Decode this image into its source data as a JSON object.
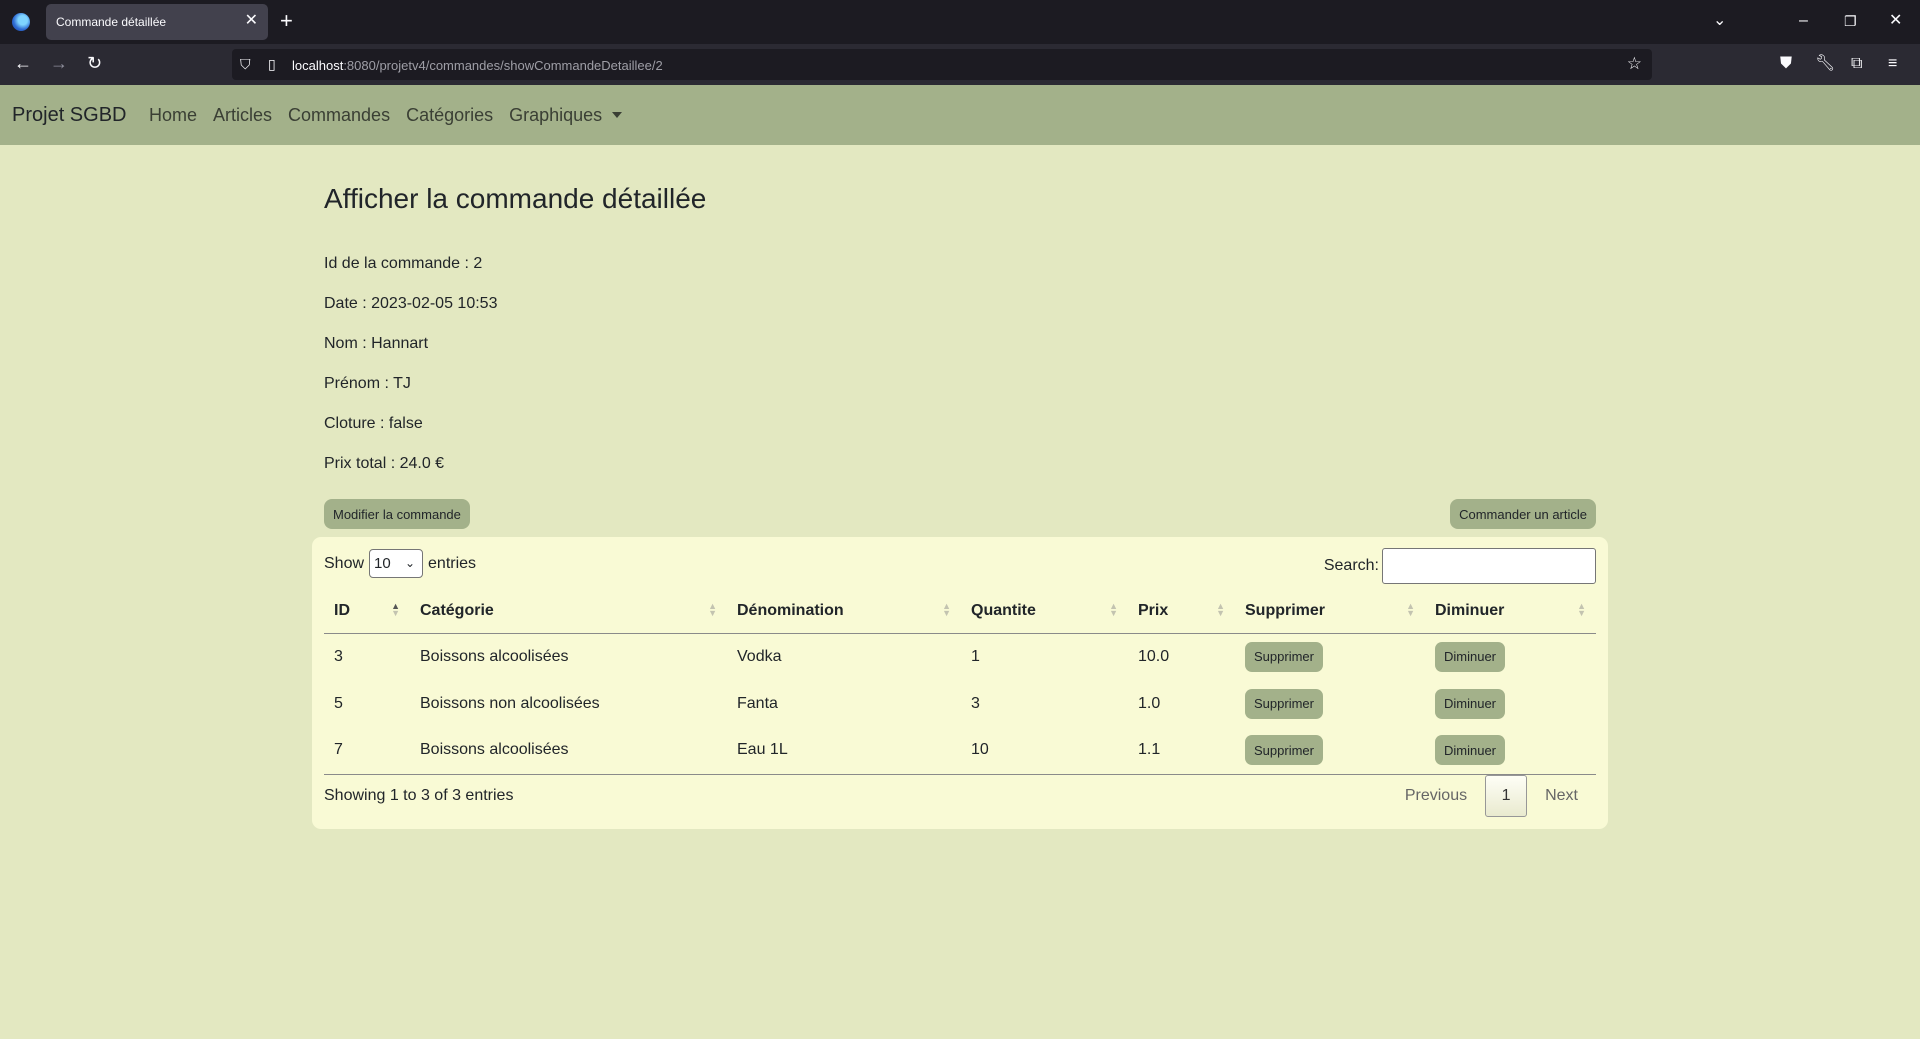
{
  "browser": {
    "tab_title": "Commande détaillée",
    "tab_close": "✕",
    "new_tab": "+",
    "url_host": "localhost",
    "url_rest": ":8080/projetv4/commandes/showCommandeDetaillee/2"
  },
  "navbar": {
    "brand": "Projet SGBD",
    "links": [
      "Home",
      "Articles",
      "Commandes",
      "Catégories",
      "Graphiques"
    ]
  },
  "page": {
    "title": "Afficher la commande détaillée",
    "info": [
      "Id de la commande : 2",
      "Date : 2023-02-05 10:53",
      "Nom : Hannart",
      "Prénom : TJ",
      "Cloture : false",
      "Prix total : 24.0 €"
    ],
    "modify_button": "Modifier la commande",
    "order_button": "Commander un article"
  },
  "table": {
    "show_label": "Show",
    "entries_label": "entries",
    "page_size": "10",
    "search_label": "Search:",
    "search_value": "",
    "headers": [
      "ID",
      "Catégorie",
      "Dénomination",
      "Quantite",
      "Prix",
      "Supprimer",
      "Diminuer"
    ],
    "rows": [
      {
        "id": "3",
        "categorie": "Boissons alcoolisées",
        "denomination": "Vodka",
        "quantite": "1",
        "prix": "10.0",
        "supprimer": "Supprimer",
        "diminuer": "Diminuer"
      },
      {
        "id": "5",
        "categorie": "Boissons non alcoolisées",
        "denomination": "Fanta",
        "quantite": "3",
        "prix": "1.0",
        "supprimer": "Supprimer",
        "diminuer": "Diminuer"
      },
      {
        "id": "7",
        "categorie": "Boissons alcoolisées",
        "denomination": "Eau 1L",
        "quantite": "10",
        "prix": "1.1",
        "supprimer": "Supprimer",
        "diminuer": "Diminuer"
      }
    ],
    "footer_info": "Showing 1 to 3 of 3 entries",
    "pagination": {
      "previous": "Previous",
      "current": "1",
      "next": "Next"
    }
  }
}
